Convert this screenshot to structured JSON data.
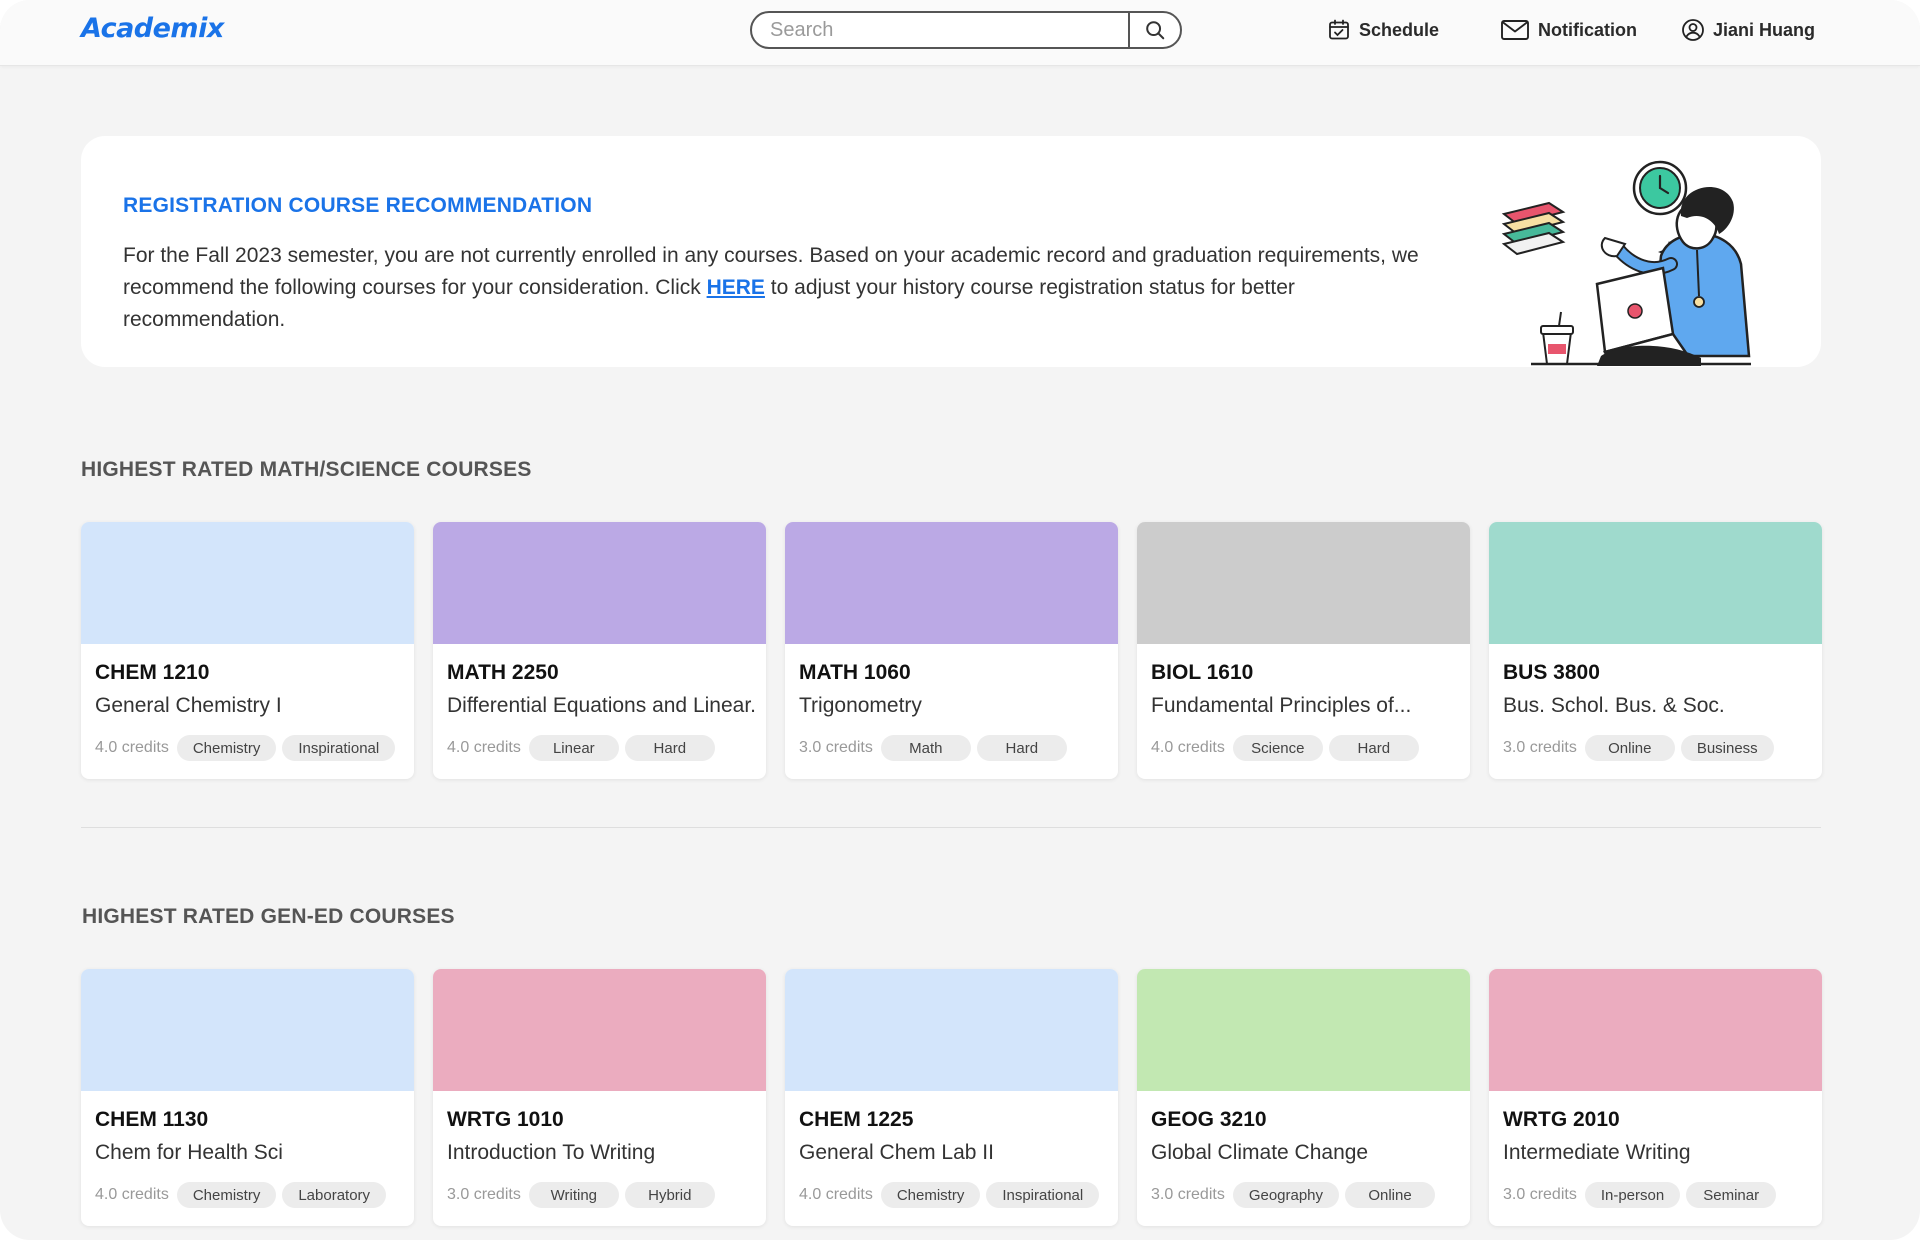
{
  "header": {
    "logo": "Academix",
    "search_placeholder": "Search",
    "nav": {
      "schedule": "Schedule",
      "notification": "Notification",
      "user": "Jiani Huang"
    }
  },
  "banner": {
    "title": "REGISTRATION COURSE RECOMMENDATION",
    "text_before": "For the Fall 2023 semester, you are not currently enrolled in any courses. Based on your academic record and graduation requirements, we recommend the following courses for your consideration. Click ",
    "link": "HERE",
    "text_after": " to adjust your history course registration status for better recommendation."
  },
  "sections": [
    {
      "title": "HIGHEST RATED MATH/SCIENCE COURSES",
      "cards": [
        {
          "color": "#d3e5fb",
          "code": "CHEM 1210",
          "name": "General Chemistry I",
          "credits": "4.0 credits",
          "tags": [
            "Chemistry",
            "Inspirational"
          ]
        },
        {
          "color": "#bba9e5",
          "code": "MATH 2250",
          "name": "Differential Equations and Linear..",
          "credits": "4.0 credits",
          "tags": [
            "Linear",
            "Hard"
          ]
        },
        {
          "color": "#bba9e5",
          "code": "MATH 1060",
          "name": "Trigonometry",
          "credits": "3.0 credits",
          "tags": [
            "Math",
            "Hard"
          ]
        },
        {
          "color": "#cccccc",
          "code": "BIOL 1610",
          "name": "Fundamental Principles of...",
          "credits": "4.0 credits",
          "tags": [
            "Science",
            "Hard"
          ]
        },
        {
          "color": "#9fdacd",
          "code": "BUS 3800",
          "name": "Bus. Schol. Bus. & Soc.",
          "credits": "3.0 credits",
          "tags": [
            "Online",
            "Business"
          ]
        }
      ]
    },
    {
      "title": "HIGHEST RATED GEN-ED COURSES",
      "cards": [
        {
          "color": "#d3e5fb",
          "code": "CHEM 1130",
          "name": "Chem for Health Sci",
          "credits": "4.0 credits",
          "tags": [
            "Chemistry",
            "Laboratory"
          ]
        },
        {
          "color": "#ebacbf",
          "code": "WRTG 1010",
          "name": "Introduction To Writing",
          "credits": "3.0 credits",
          "tags": [
            "Writing",
            "Hybrid"
          ]
        },
        {
          "color": "#d3e5fb",
          "code": "CHEM 1225",
          "name": "General Chem Lab II",
          "credits": "4.0 credits",
          "tags": [
            "Chemistry",
            "Inspirational"
          ]
        },
        {
          "color": "#c2e8b2",
          "code": "GEOG 3210",
          "name": "Global Climate Change",
          "credits": "3.0 credits",
          "tags": [
            "Geography",
            "Online"
          ]
        },
        {
          "color": "#ebacbf",
          "code": "WRTG 2010",
          "name": "Intermediate Writing",
          "credits": "3.0 credits",
          "tags": [
            "In-person",
            "Seminar"
          ]
        }
      ]
    }
  ]
}
